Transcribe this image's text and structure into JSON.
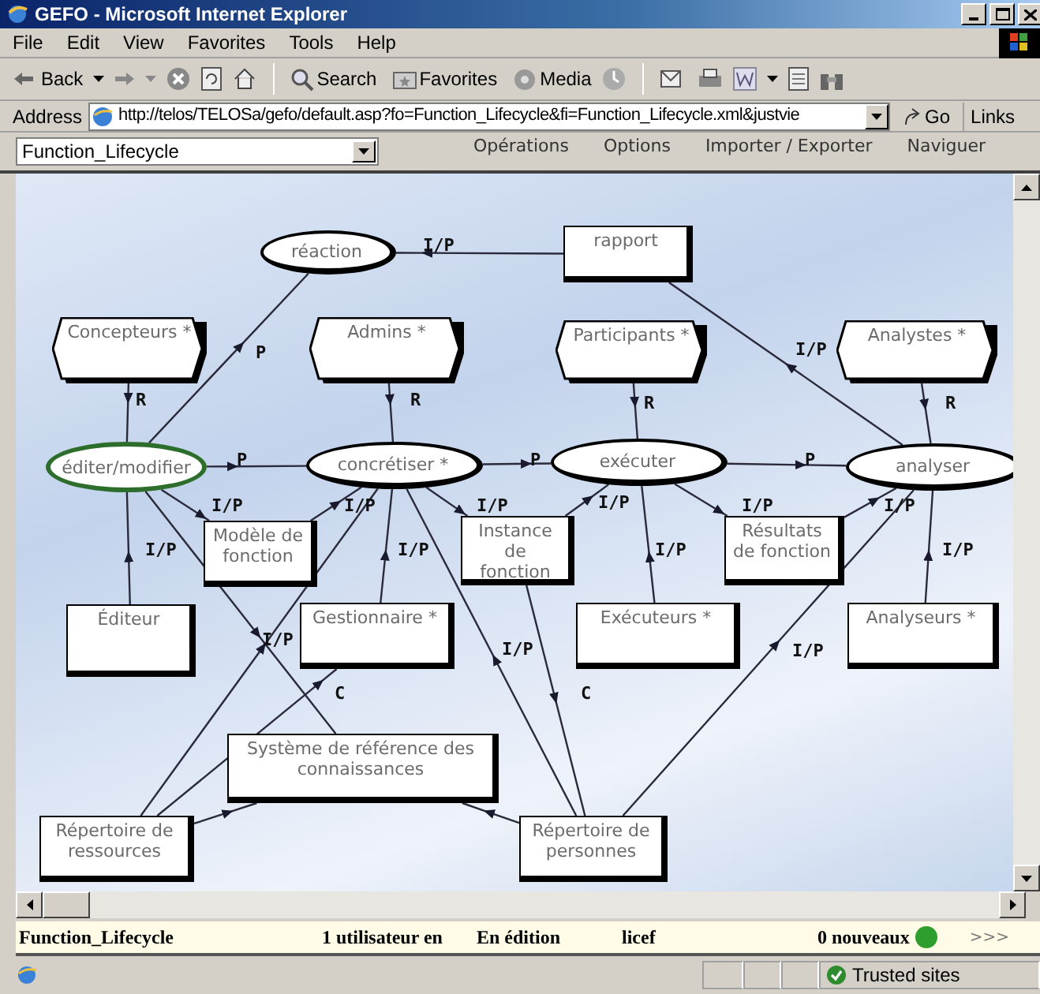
{
  "window": {
    "title": "GEFO - Microsoft Internet Explorer"
  },
  "menu_bar": [
    "File",
    "Edit",
    "View",
    "Favorites",
    "Tools",
    "Help"
  ],
  "toolbar": [
    "Back",
    "Search",
    "Favorites",
    "Media"
  ],
  "address": {
    "label": "Address",
    "value": "http://telos/TELOSa/gefo/default.asp?fo=Function_Lifecycle&fi=Function_Lifecycle.xml&justvie",
    "go": "Go",
    "links": "Links"
  },
  "app_toolbar": {
    "diagram_select": "Function_Lifecycle",
    "menus": [
      "Opérations",
      "Options",
      "Importer / Exporter",
      "Naviguer"
    ]
  },
  "diagram": {
    "nodes": [
      {
        "label": "réaction",
        "kind": "ellipse",
        "selected": false
      },
      {
        "label": "rapport",
        "kind": "rect",
        "selected": false
      },
      {
        "label": "Concepteurs *",
        "kind": "hexagon",
        "selected": false
      },
      {
        "label": "Admins *",
        "kind": "hexagon",
        "selected": false
      },
      {
        "label": "Participants *",
        "kind": "hexagon",
        "selected": false
      },
      {
        "label": "Analystes *",
        "kind": "hexagon",
        "selected": false
      },
      {
        "label": "éditer/modifier",
        "kind": "ellipse",
        "selected": true
      },
      {
        "label": "concrétiser *",
        "kind": "ellipse",
        "selected": false
      },
      {
        "label": "exécuter",
        "kind": "ellipse",
        "selected": false
      },
      {
        "label": "analyser",
        "kind": "ellipse",
        "selected": false
      },
      {
        "label": "Modèle de fonction",
        "kind": "rect",
        "selected": false
      },
      {
        "label": "Instance de fonction",
        "kind": "rect",
        "selected": false
      },
      {
        "label": "Résultats de fonction",
        "kind": "rect",
        "selected": false
      },
      {
        "label": "Éditeur",
        "kind": "rect",
        "selected": false
      },
      {
        "label": "Gestionnaire *",
        "kind": "rect",
        "selected": false
      },
      {
        "label": "Exécuteurs *",
        "kind": "rect",
        "selected": false
      },
      {
        "label": "Analyseurs *",
        "kind": "rect",
        "selected": false
      },
      {
        "label": "Système de référence des connaissances",
        "kind": "rect",
        "selected": false
      },
      {
        "label": "Répertoire de ressources",
        "kind": "rect",
        "selected": false
      },
      {
        "label": "Répertoire de personnes",
        "kind": "rect",
        "selected": false
      }
    ],
    "edge_labels": [
      "I/P",
      "P",
      "R",
      "R",
      "R",
      "R",
      "I/P",
      "P",
      "P",
      "P",
      "I/P",
      "I/P",
      "I/P",
      "I/P",
      "I/P",
      "I/P",
      "I/P",
      "I/P",
      "I/P",
      "I/P",
      "I/P",
      "C",
      "C",
      "I/P",
      "I/P"
    ]
  },
  "status_bar": {
    "fields": [
      "Function_Lifecycle",
      "1 utilisateur en",
      "En édition",
      "licef",
      "0 nouveaux"
    ],
    "indicator": {
      "color": "#2e9e2e"
    },
    "more": ">>>"
  },
  "ie_status": {
    "zone": "Trusted sites"
  }
}
